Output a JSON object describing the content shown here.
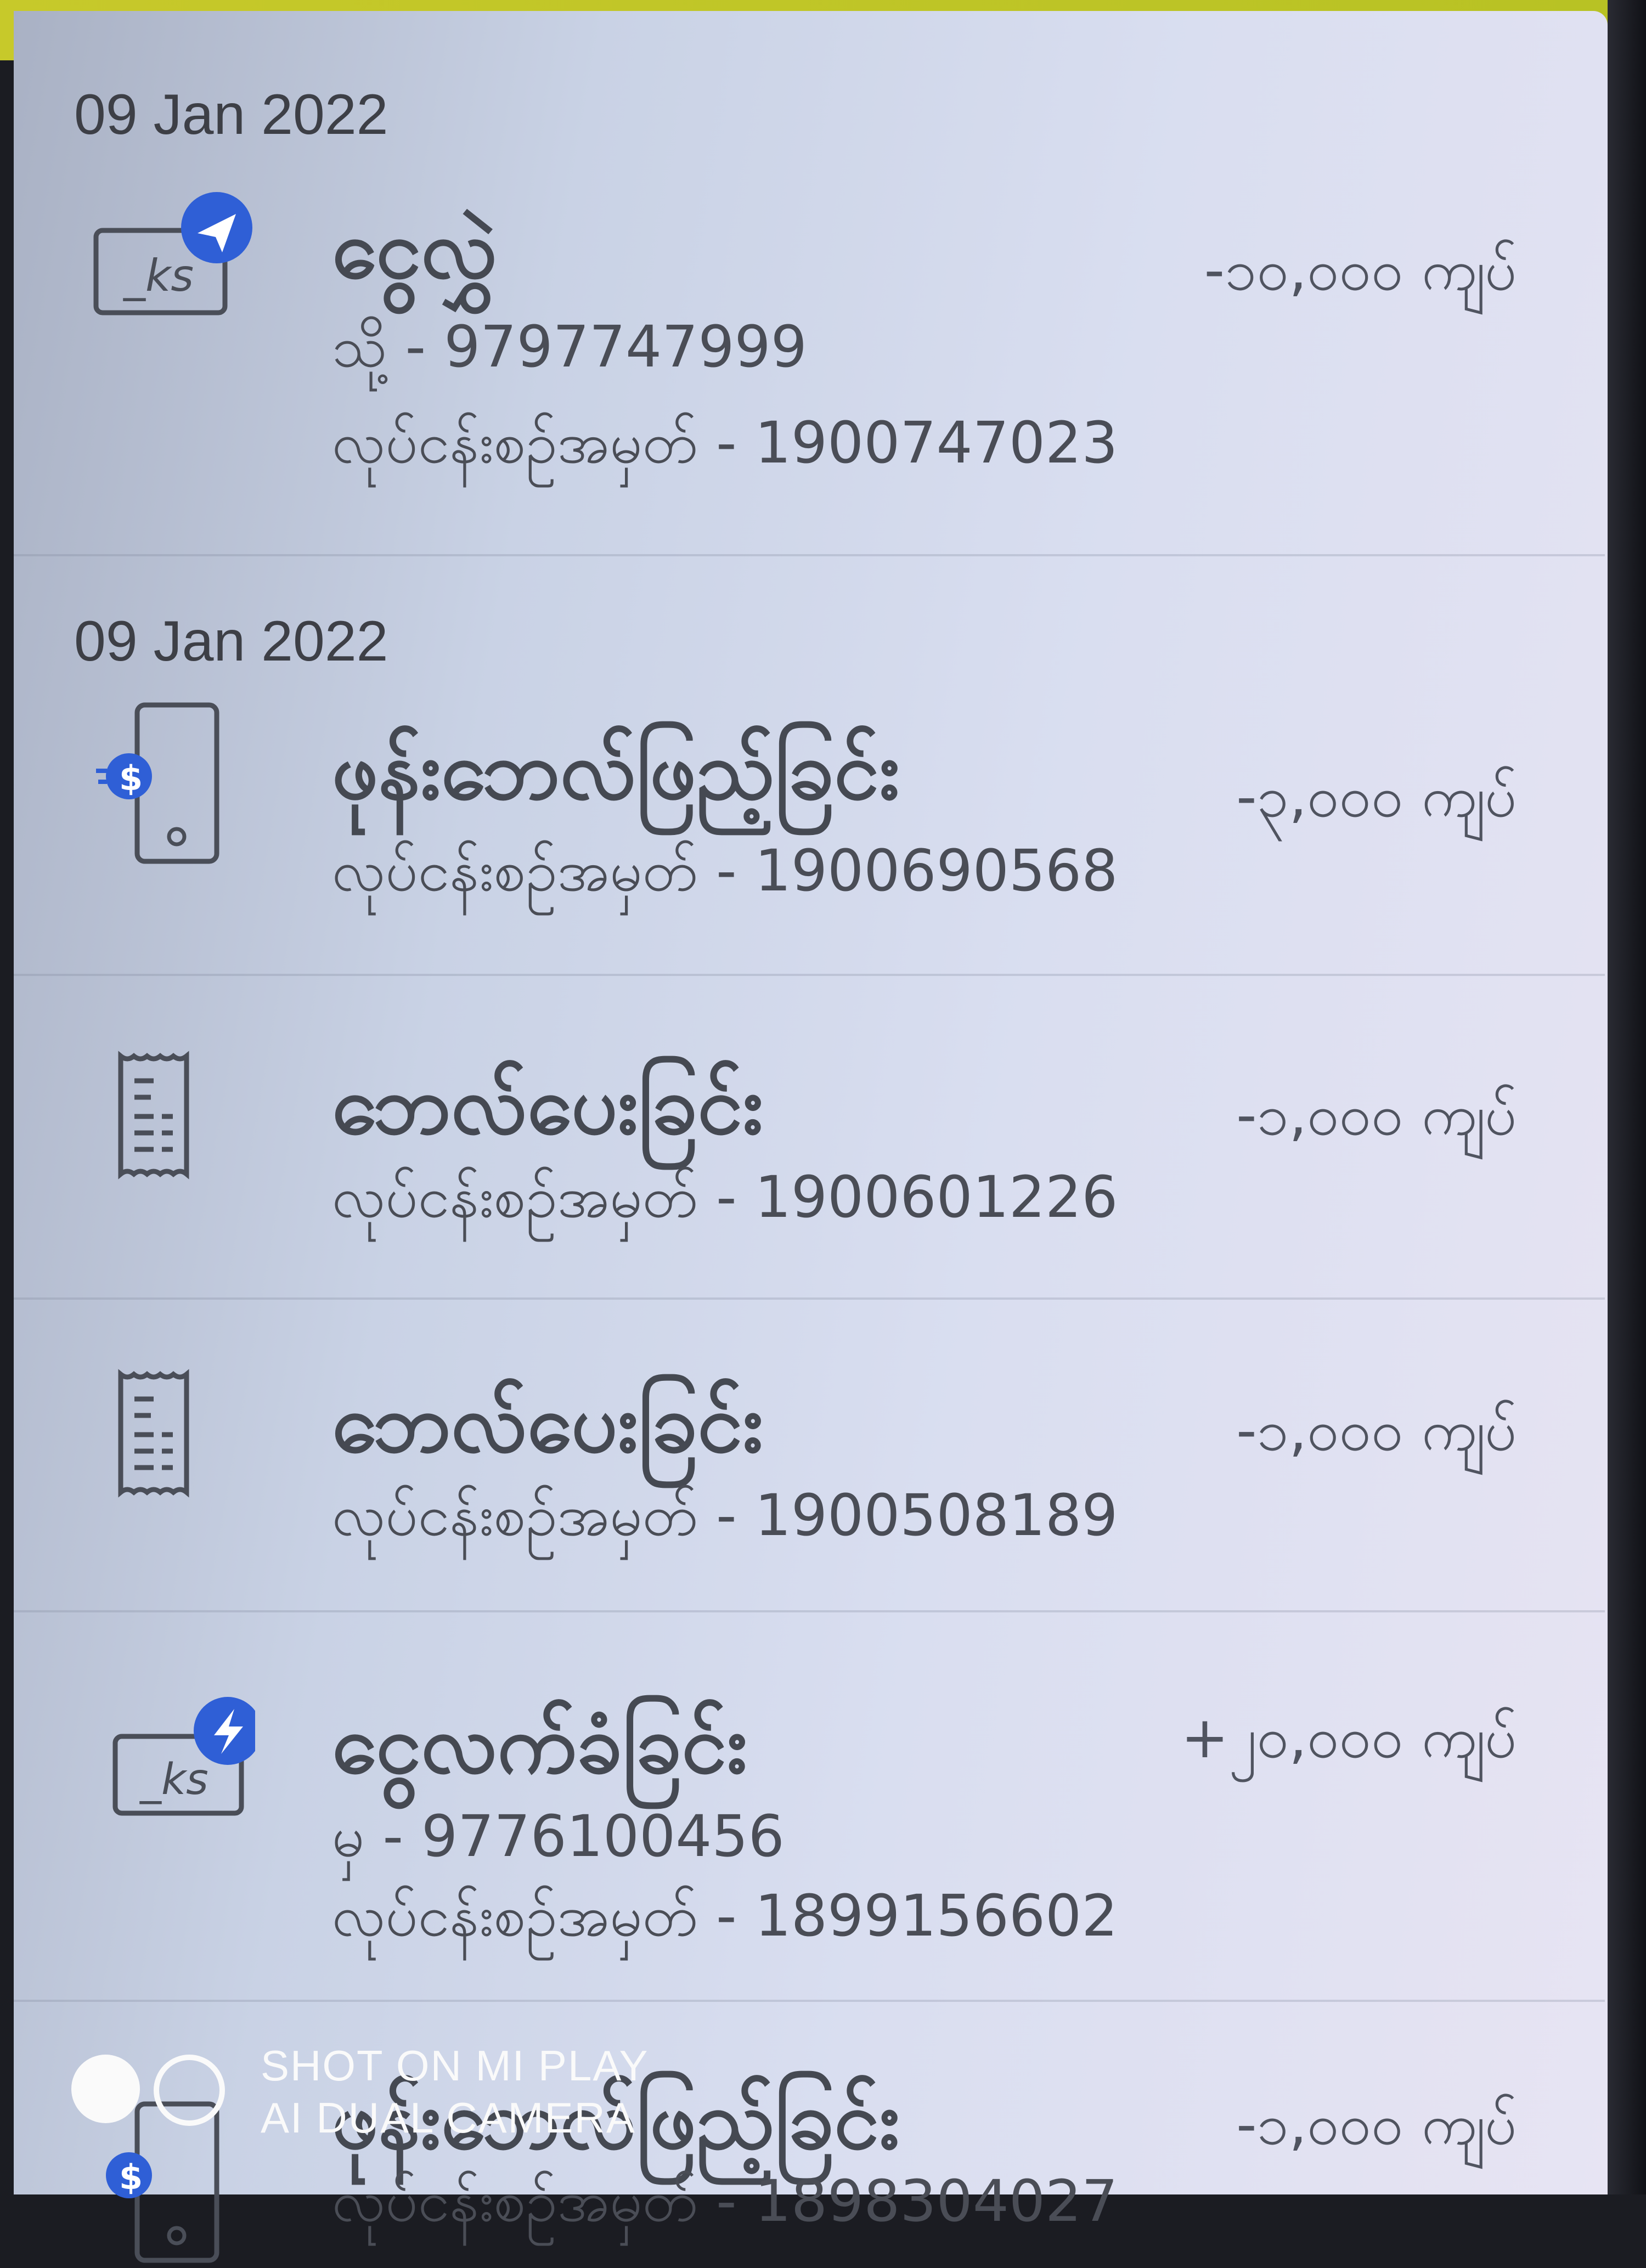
{
  "transactions": [
    {
      "date": "09 Jan 2022",
      "icon": "money-transfer-send-icon",
      "title": "ငွေလွှဲ",
      "line1": "သို့ - 9797747999",
      "line2": "လုပ်ငန်းစဉ်အမှတ် - 1900747023",
      "amount": "-၁၀,၀၀၀ ကျပ်"
    },
    {
      "date": "09 Jan 2022",
      "icon": "phone-topup-icon",
      "title": "ဖုန်းဘေလ်ဖြည့်ခြင်း",
      "line1": "လုပ်ငန်းစဉ်အမှတ် - 1900690568",
      "amount": "-၃,၀၀၀ ကျပ်"
    },
    {
      "icon": "bill-receipt-icon",
      "title": "ဘေလ်ပေးခြင်း",
      "line1": "လုပ်ငန်းစဉ်အမှတ် - 1900601226",
      "amount": "-၁,၀၀၀ ကျပ်"
    },
    {
      "icon": "bill-receipt-icon",
      "title": "ဘေလ်ပေးခြင်း",
      "line1": "လုပ်ငန်းစဉ်အမှတ် - 1900508189",
      "amount": "-၁,၀၀၀ ကျပ်"
    },
    {
      "icon": "money-receive-icon",
      "title": "ငွေလက်ခံခြင်း",
      "line1": "မှ - 9776100456",
      "line2": "လုပ်ငန်းစဉ်အမှတ် - 1899156602",
      "amount": "+၂၀,၀၀၀ ကျပ်"
    },
    {
      "icon": "phone-topup-icon",
      "title": "ဖုန်းဘေလ်ဖြည့်ခြင်း",
      "line1": "လုပ်ငန်းစဉ်အမှတ် - 1898304027",
      "amount": "-၁,၀၀၀ ကျပ်"
    }
  ],
  "watermark": {
    "line1": "SHOT ON MI PLAY",
    "line2": "AI DUAL CAMERA"
  },
  "colors": {
    "accent_blue": "#2f5fd6",
    "top_bar": "#c7c92a",
    "text": "#454952"
  }
}
